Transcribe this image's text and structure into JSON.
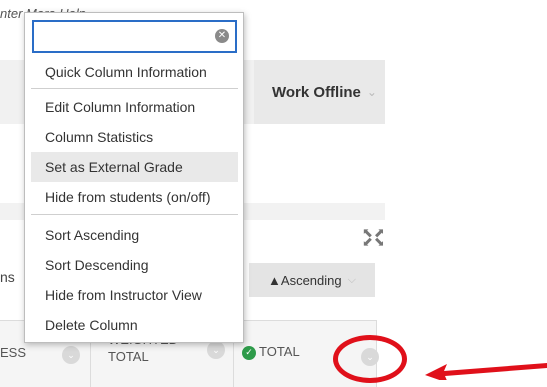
{
  "background": {
    "top_links": "nter  More Help",
    "work_offline": "Work Offline",
    "ins_label": "ns",
    "colon_label": ":",
    "sort_button": "▲Ascending",
    "table_headers": {
      "col1": "ESS",
      "col2_line1": "WEIGHTED",
      "col2_line2": "TOTAL",
      "col3": "TOTAL"
    }
  },
  "menu": {
    "search": {
      "value": "",
      "placeholder": ""
    },
    "items": [
      {
        "label": "Quick Column Information"
      },
      {
        "label": "Edit Column Information"
      },
      {
        "label": "Column Statistics"
      },
      {
        "label": "Set as External Grade",
        "highlighted": true
      },
      {
        "label": "Hide from students (on/off)"
      },
      {
        "label": "Sort Ascending"
      },
      {
        "label": "Sort Descending"
      },
      {
        "label": "Hide from Instructor View"
      },
      {
        "label": "Delete Column"
      }
    ]
  },
  "colors": {
    "annotation": "#e0101a",
    "focus_border": "#2a6dc7",
    "check_green": "#2e9b4a"
  },
  "icons": [
    "clear-icon",
    "expand-icon",
    "chevron-down-icon",
    "check-circle-icon",
    "arrow-icon"
  ]
}
